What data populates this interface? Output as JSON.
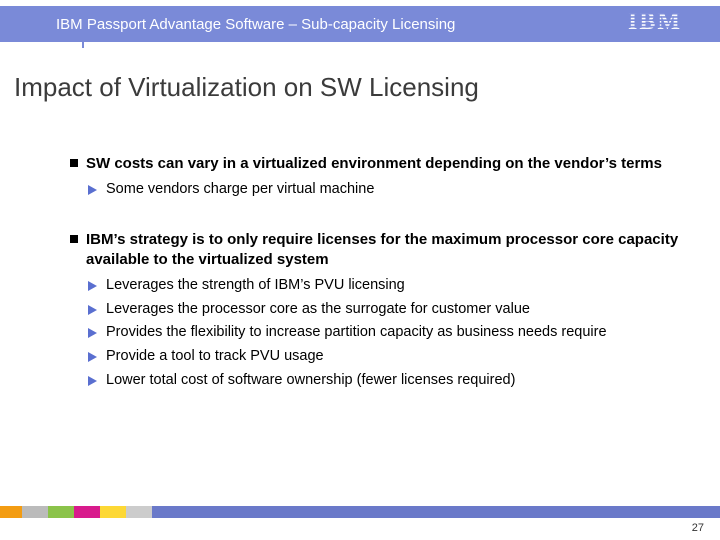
{
  "header": {
    "text": "IBM Passport Advantage Software – Sub-capacity Licensing",
    "logo_label": "IBM"
  },
  "title": "Impact of Virtualization on SW Licensing",
  "bullets": [
    {
      "text": "SW costs can vary in a virtualized environment depending on the vendor’s terms",
      "sub": [
        "Some vendors charge per virtual machine"
      ]
    },
    {
      "text": "IBM’s strategy is to only require licenses for the maximum processor core capacity available to the virtualized system",
      "sub": [
        "Leverages the strength of IBM’s PVU licensing",
        "Leverages the processor core as the surrogate for customer value",
        "Provides the flexibility to increase partition capacity as business needs require",
        "Provide a tool to track PVU usage",
        "Lower total cost of software ownership (fewer licenses required)"
      ]
    }
  ],
  "footer": {
    "page_number": "27",
    "stripe_colors": [
      "#f39c12",
      "#bbbbbb",
      "#8bc34a",
      "#d81b8c",
      "#fdd835",
      "#cccccc",
      "#6a79c9"
    ]
  }
}
